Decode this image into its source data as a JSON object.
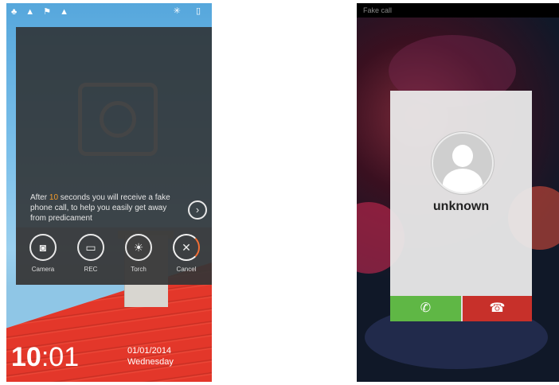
{
  "left_screen": {
    "status_bar": {
      "left_icons": "♣ ▲ ⚑ ▲",
      "right_icons": "✳ ▯"
    },
    "fake_call_info": {
      "text_before": "After ",
      "seconds": "10",
      "text_after": " seconds you will receive a fake phone call, to help you easily get away from predicament"
    },
    "actions": [
      {
        "label": "Camera",
        "icon": "camera-icon"
      },
      {
        "label": "REC",
        "icon": "recorder-icon"
      },
      {
        "label": "Torch",
        "icon": "torch-icon"
      },
      {
        "label": "Cancel",
        "icon": "close-icon"
      }
    ],
    "clock": {
      "hours": "10",
      "separator": ":",
      "minutes": "01"
    },
    "date": {
      "date": "01/01/2014",
      "weekday": "Wednesday"
    }
  },
  "right_screen": {
    "status_bar_text": "Fake call",
    "caller_name": "unknown",
    "answer_icon": "phone-answer-icon",
    "decline_icon": "phone-decline-icon",
    "colors": {
      "answer": "#5fb745",
      "decline": "#c7302a",
      "highlight": "#f39c2a"
    }
  }
}
